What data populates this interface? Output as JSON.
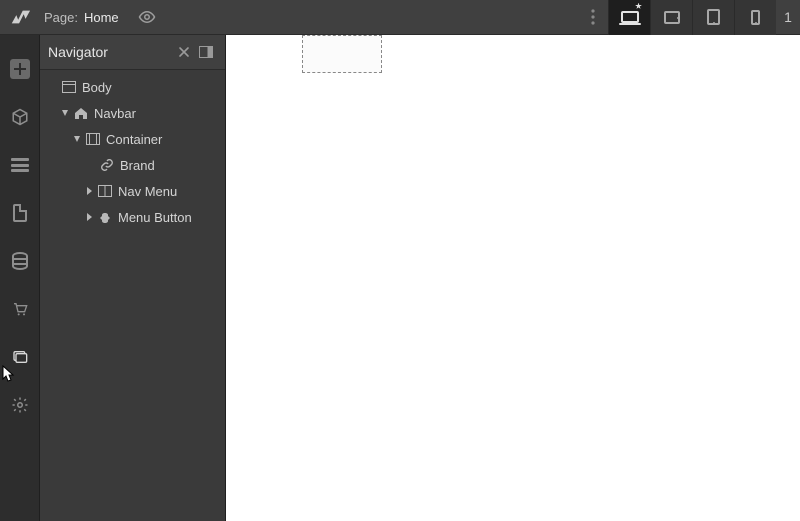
{
  "topbar": {
    "page_label": "Page:",
    "page_name": "Home",
    "breakpoint_count": "1"
  },
  "panel": {
    "title": "Navigator"
  },
  "tree": {
    "body": "Body",
    "navbar": "Navbar",
    "container": "Container",
    "brand": "Brand",
    "nav_menu": "Nav Menu",
    "menu_button": "Menu Button"
  }
}
